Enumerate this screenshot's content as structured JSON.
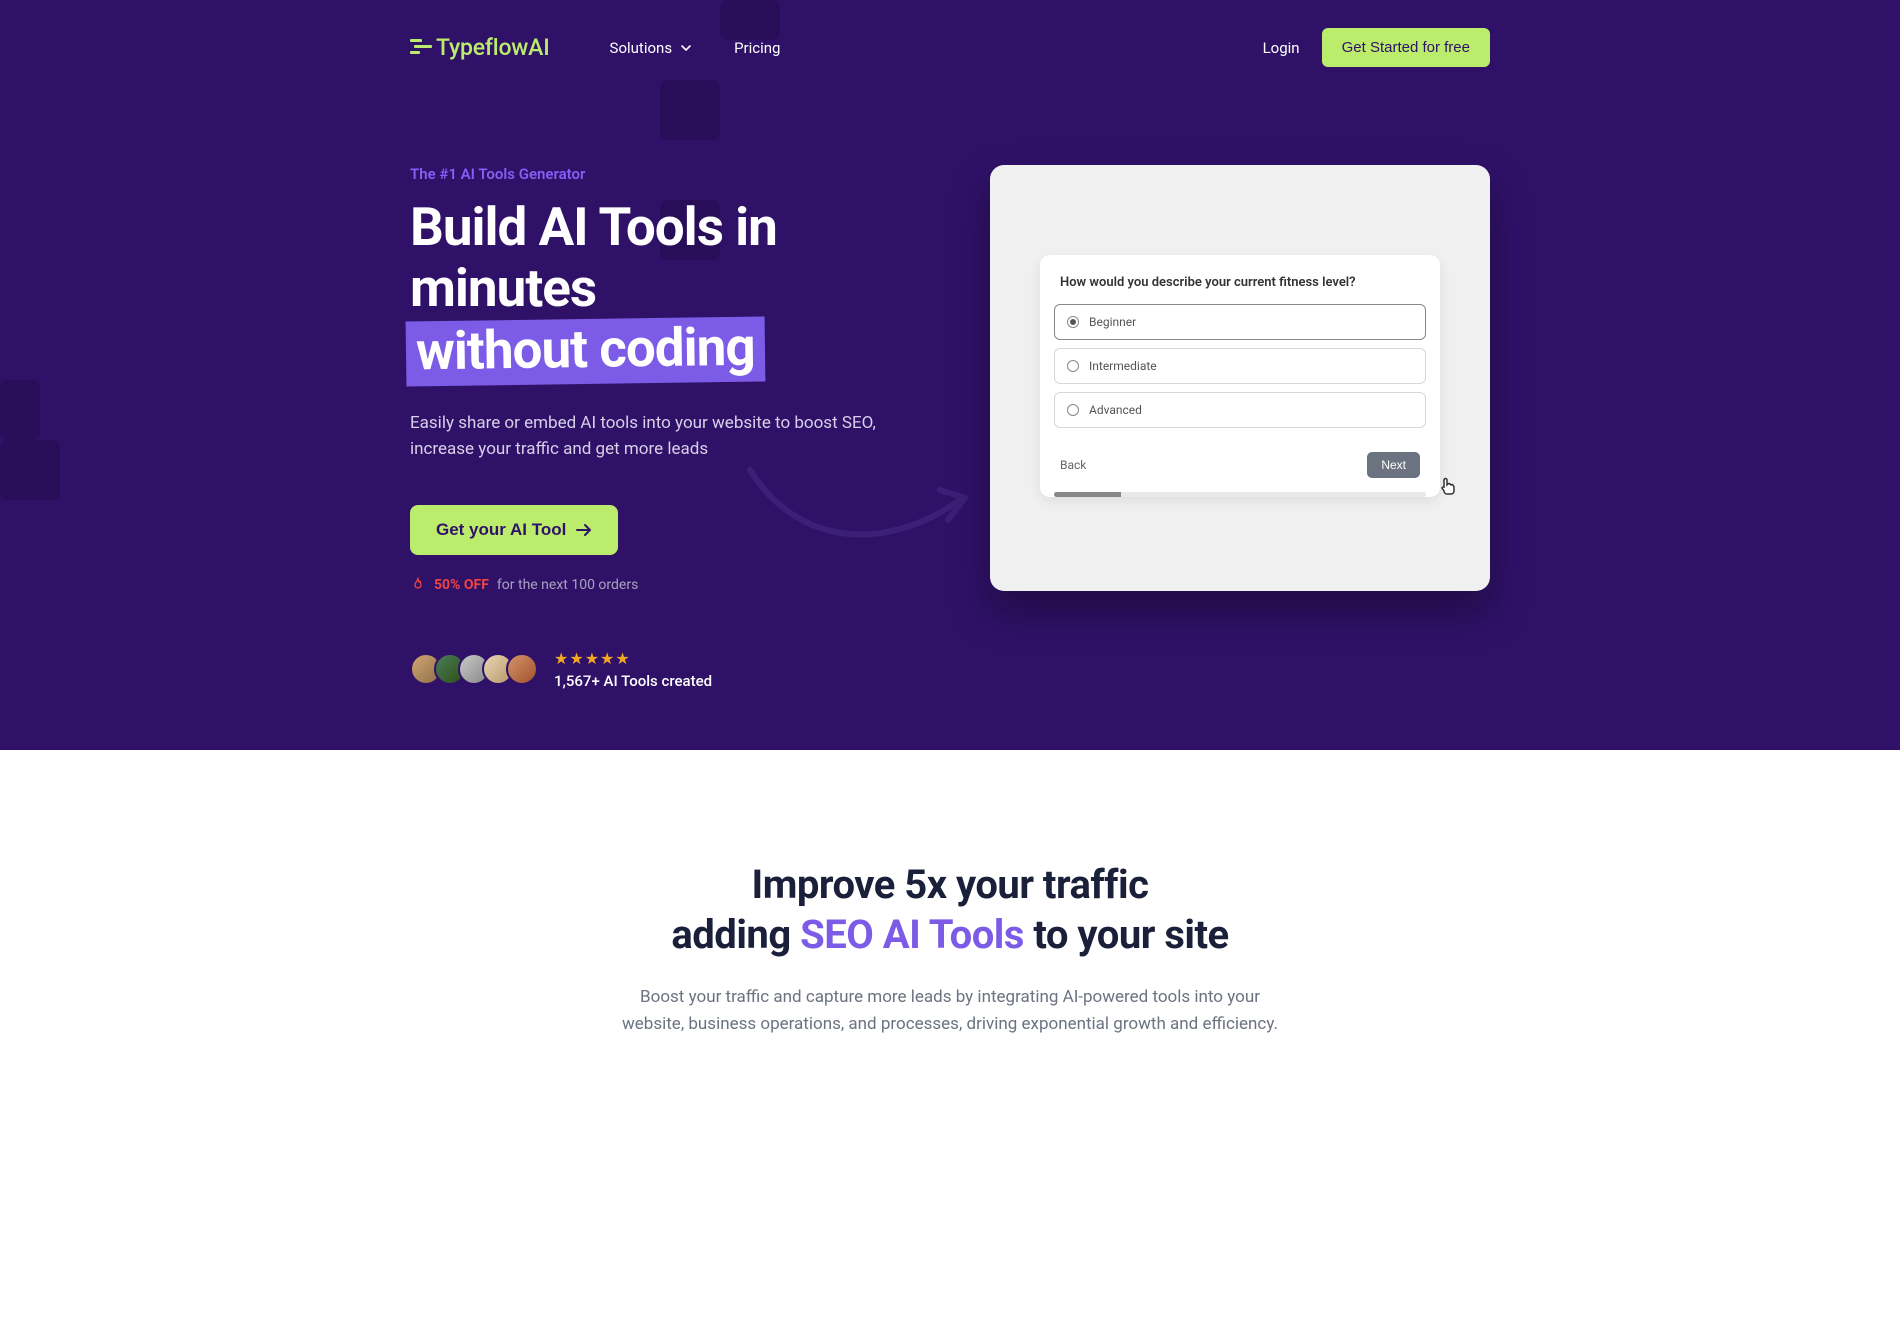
{
  "nav": {
    "logo": "TypeflowAI",
    "links": {
      "solutions": "Solutions",
      "pricing": "Pricing"
    },
    "login": "Login",
    "cta": "Get Started for free"
  },
  "hero": {
    "eyebrow": "The #1 AI Tools Generator",
    "title_line1": "Build AI Tools in",
    "title_line2a": "minutes",
    "title_line2b": "without coding",
    "description": "Easily share or embed AI tools into your website to boost SEO, increase your traffic and get more leads",
    "cta": "Get your AI Tool",
    "promo_off": "50% OFF",
    "promo_text": "for the next 100 orders",
    "social_count": "1,567+ AI Tools created"
  },
  "demo": {
    "question": "How would you describe your current fitness level?",
    "options": [
      "Beginner",
      "Intermediate",
      "Advanced"
    ],
    "back": "Back",
    "next": "Next"
  },
  "section2": {
    "title_line1": "Improve 5x your traffic",
    "title_line2a": "adding ",
    "title_line2b": "SEO AI Tools",
    "title_line2c": " to your site",
    "description": "Boost your traffic and capture more leads by integrating AI-powered tools into your website, business operations, and processes, driving exponential growth and efficiency."
  }
}
